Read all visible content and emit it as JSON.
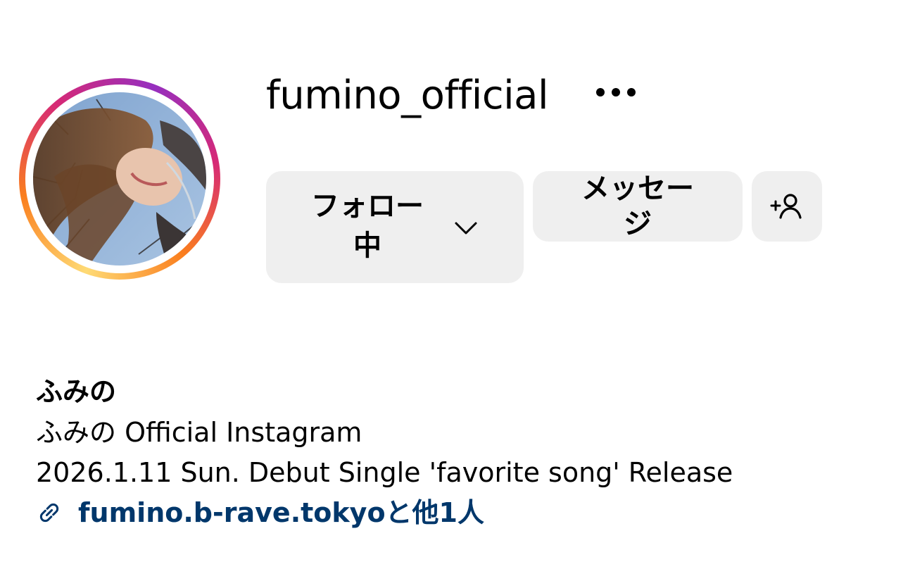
{
  "profile": {
    "username": "fumino_official",
    "display_name": "ふみの",
    "bio_lines": [
      "ふみの Official Instagram",
      "2026.1.11 Sun. Debut Single 'favorite song' Release"
    ],
    "link": {
      "text": "fumino.b-rave.tokyoと他1人",
      "color": "#00376b"
    },
    "avatar": {
      "has_story_ring": true,
      "ring_colors": [
        "#feda75",
        "#fa7e1e",
        "#d62976",
        "#962fbf"
      ]
    }
  },
  "actions": {
    "follow_label": "フォロー\n中",
    "message_label": "メッセー\nジ",
    "follow_dropdown_icon": "chevron-down-icon",
    "add_user_icon": "add-user-icon",
    "more_icon": "more-options-icon",
    "button_bg": "#efefef"
  }
}
